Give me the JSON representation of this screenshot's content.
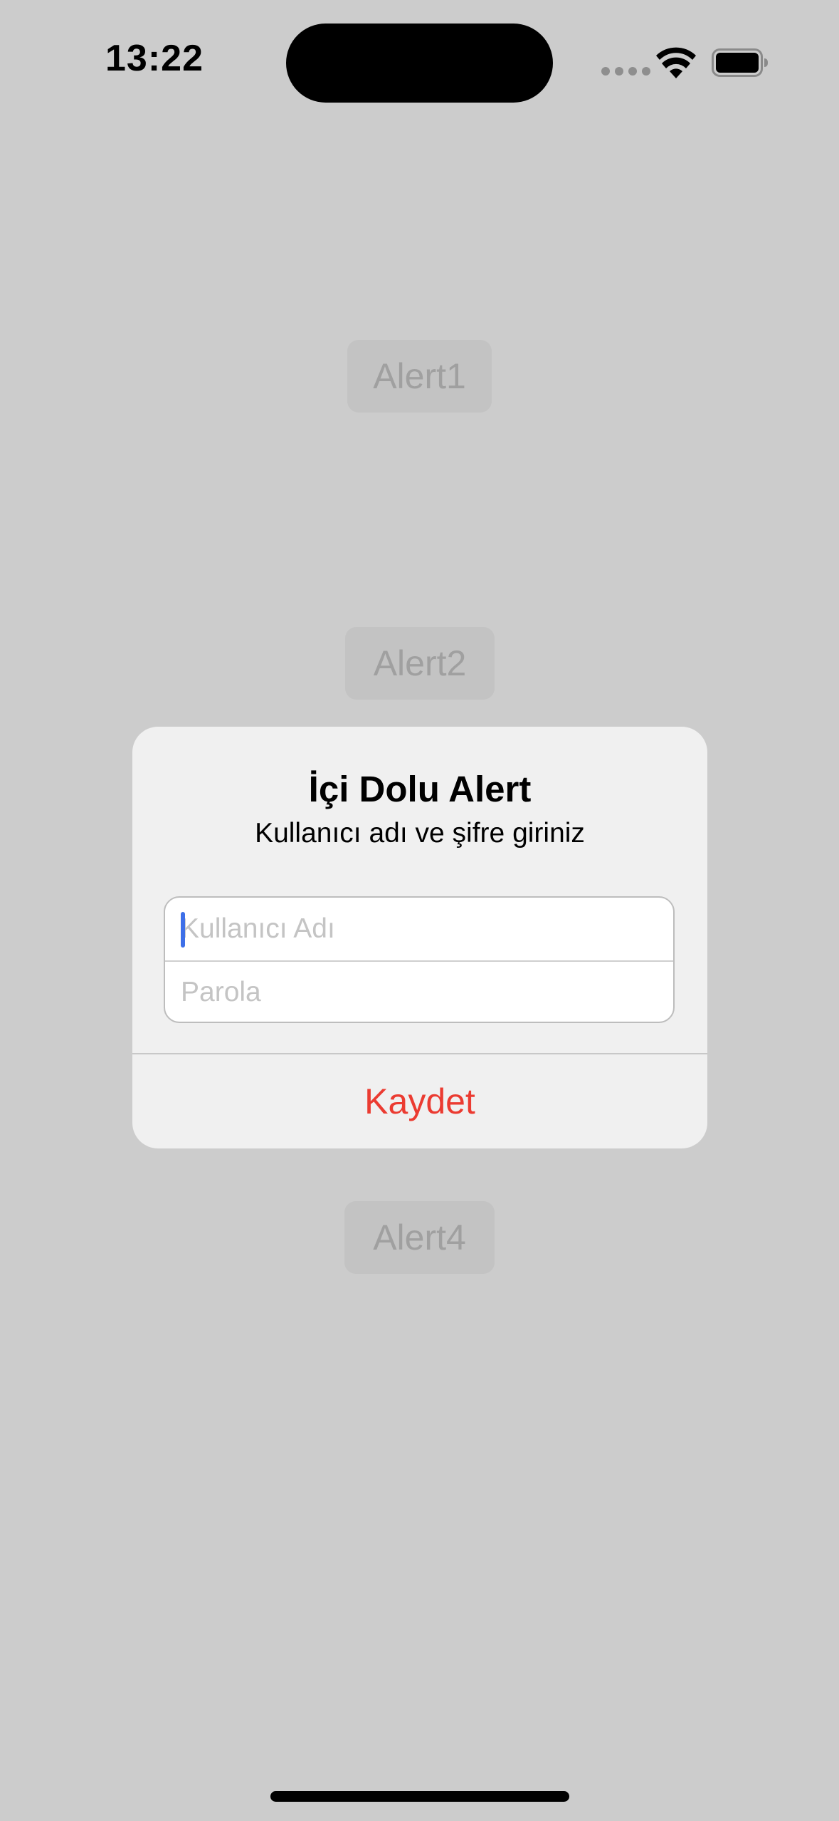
{
  "status_bar": {
    "time": "13:22",
    "icons": [
      "signal-dots-icon",
      "wifi-icon",
      "battery-icon"
    ]
  },
  "background": {
    "buttons": [
      {
        "label": "Alert1"
      },
      {
        "label": "Alert2"
      },
      {
        "label": "Alert4"
      }
    ]
  },
  "alert": {
    "title": "İçi Dolu Alert",
    "message": "Kullanıcı adı ve şifre giriniz",
    "fields": [
      {
        "placeholder": "Kullanıcı Adı",
        "value": ""
      },
      {
        "placeholder": "Parola",
        "value": ""
      }
    ],
    "action_label": "Kaydet"
  },
  "colors": {
    "dimmed_background": "#cccccc",
    "alert_background": "#f0f0f0",
    "destructive_action": "#eb3b31",
    "cursor": "#3d6fe8"
  }
}
